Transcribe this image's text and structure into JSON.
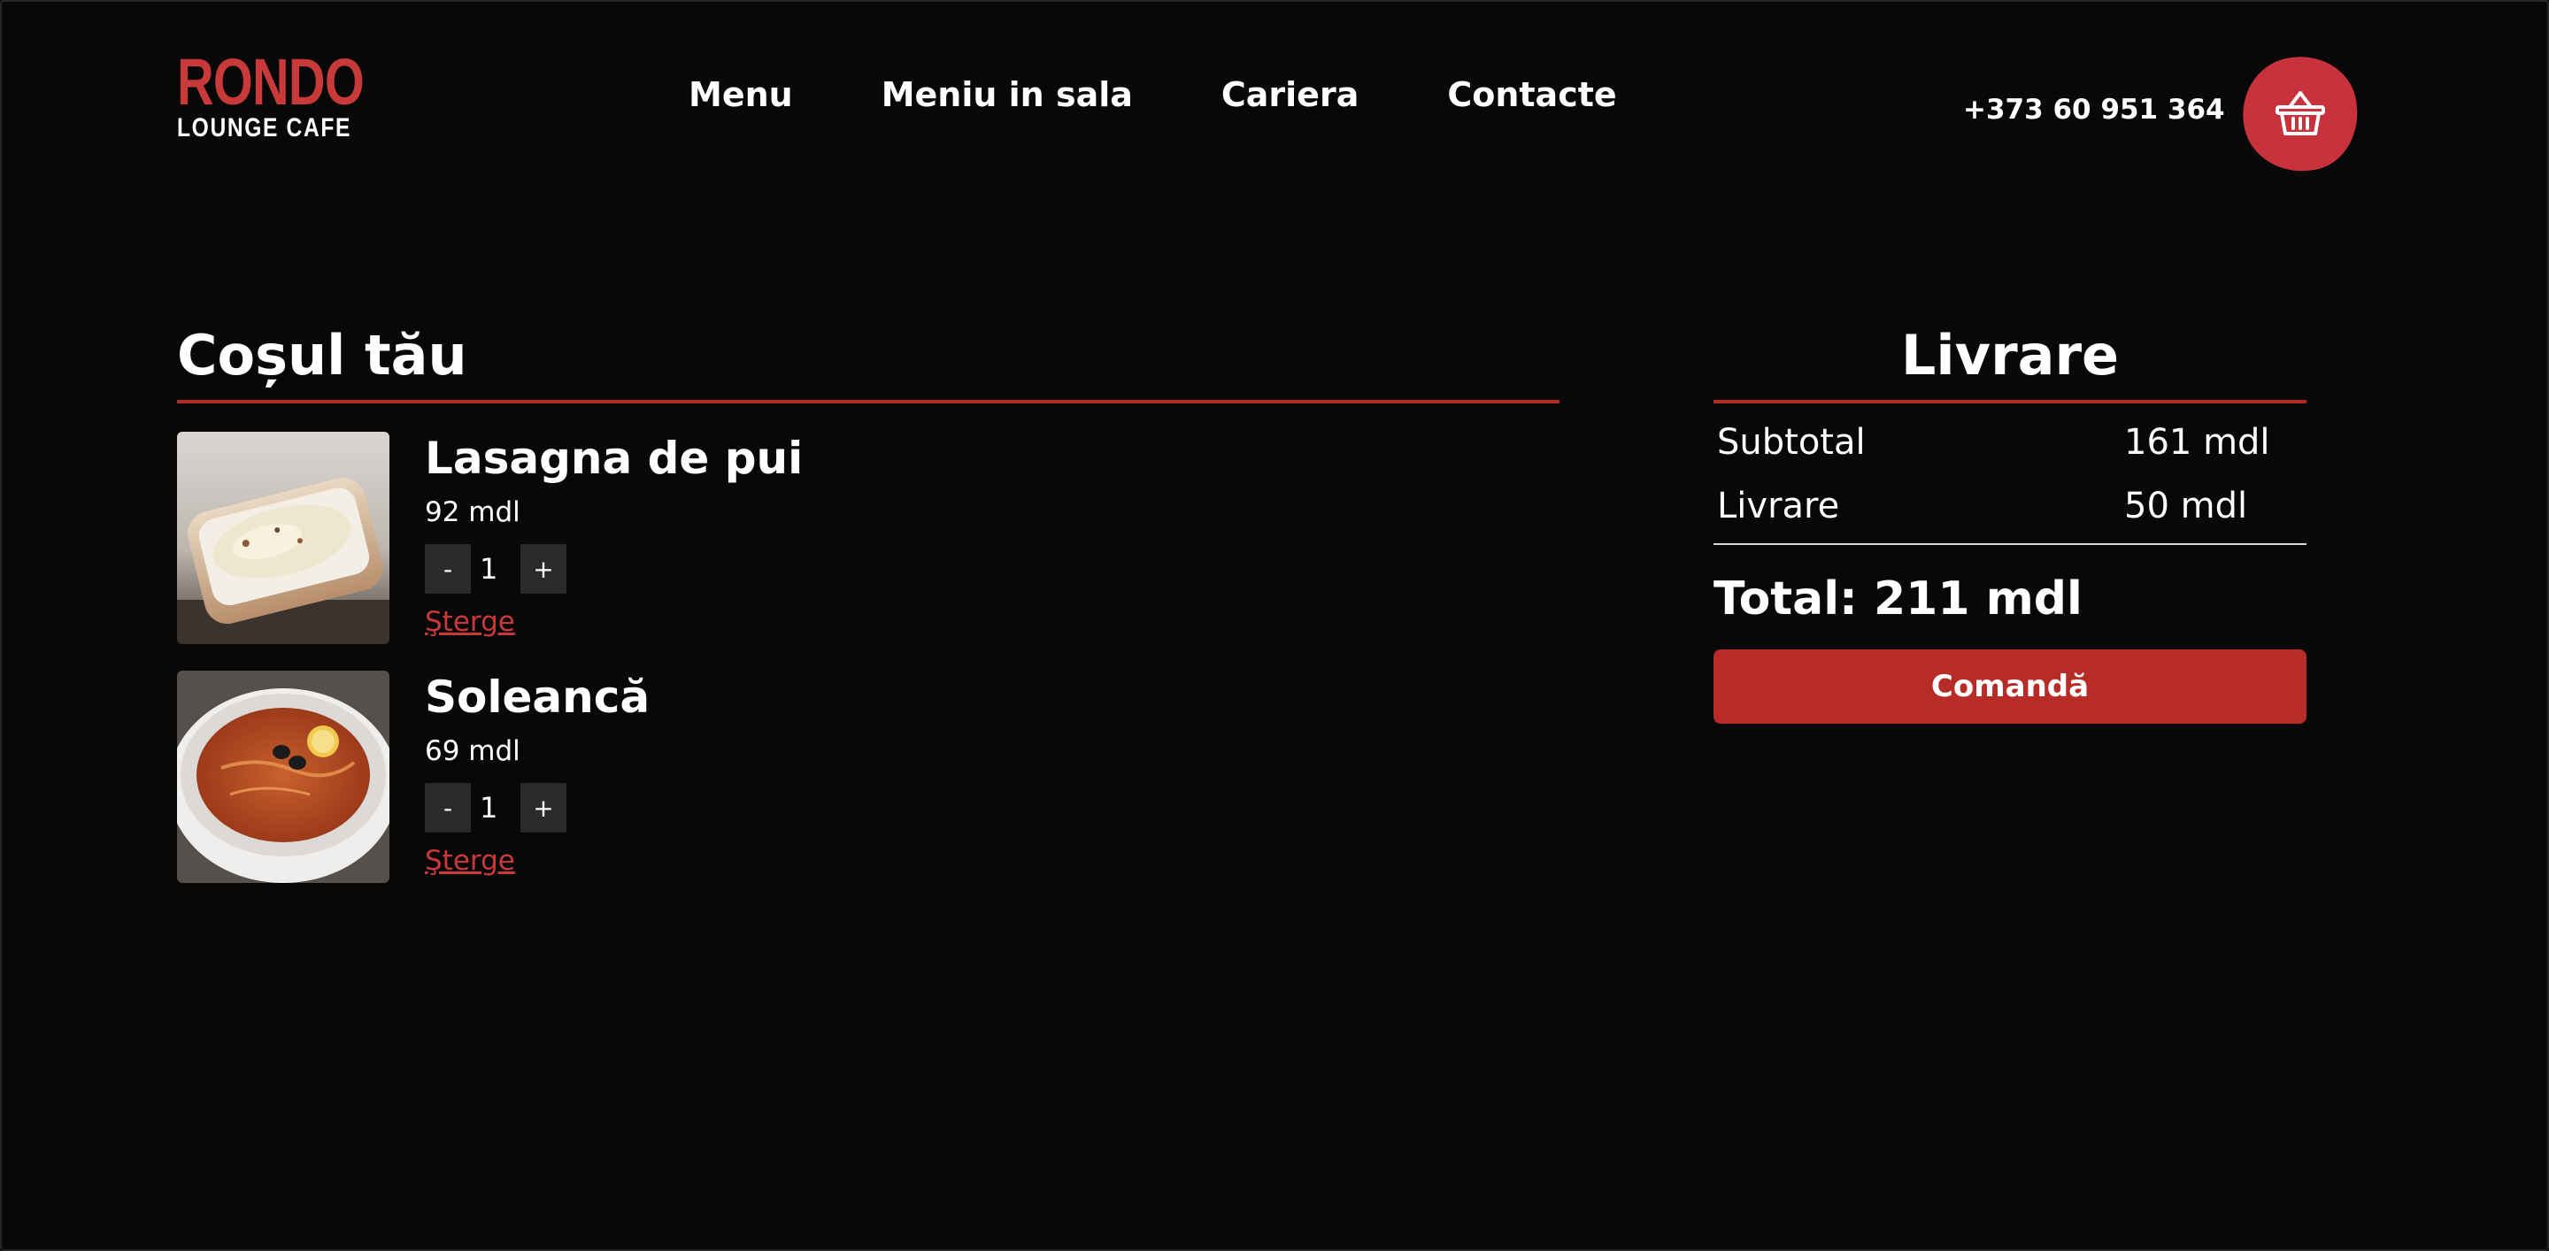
{
  "brand": {
    "name": "RONDO",
    "tagline": "LOUNGE CAFE",
    "accent_color": "#c8393a"
  },
  "nav": {
    "items": [
      {
        "label": "Menu"
      },
      {
        "label": "Meniu in sala"
      },
      {
        "label": "Cariera"
      },
      {
        "label": "Contacte"
      }
    ]
  },
  "header": {
    "phone": "+373 60 951 364",
    "cart_icon": "basket-icon"
  },
  "cart": {
    "title": "Coșul tău",
    "items": [
      {
        "name": "Lasagna de pui",
        "price": "92 mdl",
        "quantity": "1",
        "decrement": "-",
        "increment": "+",
        "remove_label": "Şterge",
        "image": "lasagna-image"
      },
      {
        "name": "Soleancă",
        "price": "69 mdl",
        "quantity": "1",
        "decrement": "-",
        "increment": "+",
        "remove_label": "Şterge",
        "image": "soup-image"
      }
    ]
  },
  "summary": {
    "title": "Livrare",
    "rows": [
      {
        "label": "Subtotal",
        "value": "161 mdl"
      },
      {
        "label": "Livrare",
        "value": "50 mdl"
      }
    ],
    "total": "Total: 211 mdl",
    "order_button": "Comandă",
    "button_color": "#b72c27"
  }
}
